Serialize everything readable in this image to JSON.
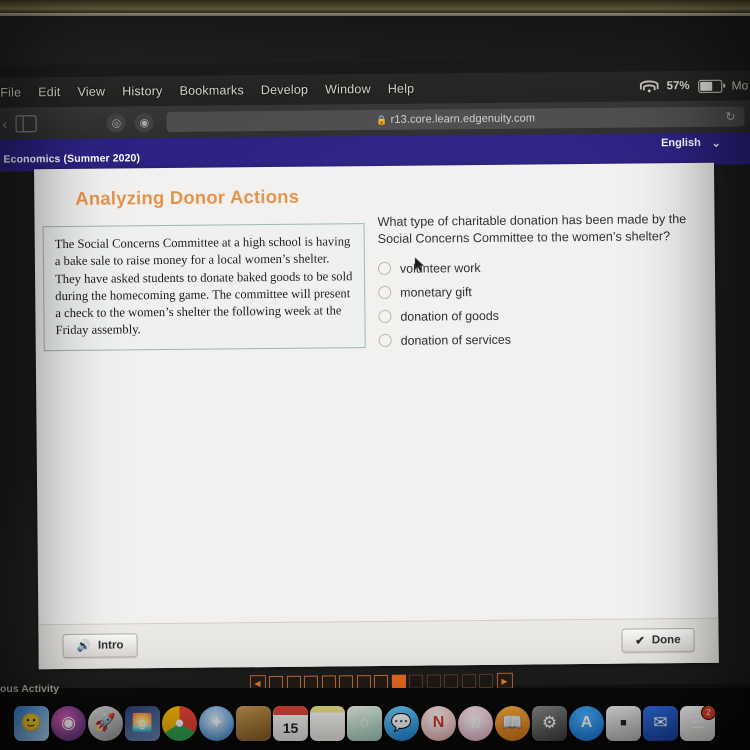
{
  "menu_bar": {
    "items": [
      "File",
      "Edit",
      "View",
      "History",
      "Bookmarks",
      "Develop",
      "Window",
      "Help"
    ],
    "wifi_icon": "wifi-icon",
    "battery_percent": "57%",
    "battery_icon": "battery-icon",
    "clock": "Mo"
  },
  "browser": {
    "back_icon": "back-chevron-icon",
    "sidebar_icon": "sidebar-toggle-icon",
    "tab_overview_icon": "tab-overview-icon",
    "shield_icon": "privacy-shield-icon",
    "lock_icon": "lock-icon",
    "url": "r13.core.learn.edgenuity.com",
    "reload_icon": "reload-icon"
  },
  "app_header": {
    "course": "- Economics (Summer 2020)",
    "language": "English",
    "chevron_icon": "chevron-down-icon"
  },
  "activity": {
    "title": "Analyzing Donor Actions",
    "passage": "The Social Concerns Committee at a high school is having a bake sale to raise money for a local women’s shelter. They have asked students to donate baked goods to be sold during the homecoming game. The committee will present a check to the women’s shelter the following week at the Friday assembly.",
    "question": "What type of charitable donation has been made by the Social Concerns Committee to the women’s shelter?",
    "options": [
      {
        "label": "volunteer work",
        "selected": false
      },
      {
        "label": "monetary gift",
        "selected": false
      },
      {
        "label": "donation of goods",
        "selected": false
      },
      {
        "label": "donation of services",
        "selected": false
      }
    ],
    "intro_button": "Intro",
    "intro_icon": "speaker-icon",
    "done_button": "Done",
    "done_icon": "checkmark-icon",
    "accent_color": "#e8934a",
    "header_color": "#2c2283"
  },
  "pagination": {
    "prev_icon": "prev-arrow-icon",
    "next_icon": "next-arrow-icon",
    "total": 13,
    "current": 8,
    "label": "8 of 13",
    "active_color": "#ea6a20"
  },
  "desktop": {
    "window_label": "ous Activity",
    "dock": [
      {
        "name": "finder",
        "glyph": "🙂",
        "bg": "linear-gradient(135deg,#2b7fd4,#bfe0f5)",
        "round": false
      },
      {
        "name": "siri",
        "glyph": "◉",
        "bg": "radial-gradient(circle at 40% 40%,#e060b8,#3a2a6e)",
        "round": true
      },
      {
        "name": "launchpad",
        "glyph": "🚀",
        "bg": "linear-gradient(135deg,#d9d9d9,#9a9a9a)",
        "round": true
      },
      {
        "name": "photos",
        "glyph": "🌅",
        "bg": "linear-gradient(160deg,#2a3f6e,#6f8fc0)",
        "round": false
      },
      {
        "name": "chrome",
        "glyph": "●",
        "bg": "conic-gradient(#ea4335 0 33%,#34a853 0 66%,#fbbc05 0 100%)",
        "round": true
      },
      {
        "name": "safari",
        "glyph": "✦",
        "bg": "radial-gradient(circle at 45% 40%,#e8f3fb,#1a7ad4)",
        "round": true
      },
      {
        "name": "contacts",
        "glyph": "",
        "bg": "linear-gradient(150deg,#c99a52,#8a6126)",
        "round": false
      },
      {
        "name": "calendar",
        "glyph": "15",
        "bg": "#f7f6f4",
        "round": false
      },
      {
        "name": "notes",
        "glyph": "",
        "bg": "linear-gradient(180deg,#f6e88a 0 18%,#fbfaf6 18%)",
        "round": false
      },
      {
        "name": "podcasts",
        "glyph": "○",
        "bg": "linear-gradient(150deg,#eef7f0,#a9d7c4)",
        "round": false
      },
      {
        "name": "messages",
        "glyph": "💬",
        "bg": "linear-gradient(160deg,#6fd0ff,#1b8fe0)",
        "round": true
      },
      {
        "name": "news",
        "glyph": "N",
        "bg": "radial-gradient(circle at 45% 40%,#ffffff,#f3a6a6)",
        "round": true
      },
      {
        "name": "itunes",
        "glyph": "♫",
        "bg": "radial-gradient(circle at 45% 40%,#ffffff,#f0a8c8)",
        "round": true
      },
      {
        "name": "books",
        "glyph": "📖",
        "bg": "linear-gradient(160deg,#fbb040,#e07a18)",
        "round": true
      },
      {
        "name": "system-preferences",
        "glyph": "⚙",
        "bg": "linear-gradient(150deg,#8d8d8d,#3d3d3d)",
        "round": false
      },
      {
        "name": "app-store",
        "glyph": "A",
        "bg": "radial-gradient(circle at 45% 35%,#4fb4ff,#0a72d8)",
        "round": true
      },
      {
        "name": "roblox",
        "glyph": "■",
        "bg": "linear-gradient(150deg,#f0f0f0,#b8b8b8)",
        "round": false
      },
      {
        "name": "mail",
        "glyph": "✉",
        "bg": "linear-gradient(150deg,#2f6fe0,#1844a8)",
        "round": false
      },
      {
        "name": "reminders",
        "glyph": "☰",
        "bg": "linear-gradient(180deg,#ffffff,#e2e0dc)",
        "round": false,
        "badge": "2"
      }
    ]
  }
}
